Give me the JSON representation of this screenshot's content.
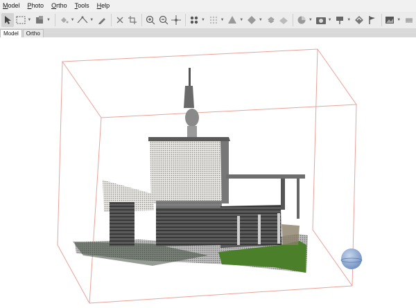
{
  "menu": [
    {
      "label": "Model",
      "underline": "M",
      "rest": "odel"
    },
    {
      "label": "Photo",
      "underline": "P",
      "rest": "hoto"
    },
    {
      "label": "Ortho",
      "underline": "O",
      "rest": "rtho"
    },
    {
      "label": "Tools",
      "underline": "T",
      "rest": "ools"
    },
    {
      "label": "Help",
      "underline": "H",
      "rest": "elp"
    }
  ],
  "tabs": [
    {
      "label": "Model",
      "active": true
    },
    {
      "label": "Ortho",
      "active": false
    }
  ],
  "toolbar_icons": [
    "navigation-icon",
    "rectangle-selection-icon",
    "brush-selection-icon",
    "paint-bucket-icon",
    "ruler-icon",
    "pencil-icon",
    "delete-icon",
    "crop-icon",
    "zoom-in-icon",
    "zoom-out-icon",
    "move-icon",
    "show-points-icon",
    "show-dense-cloud-icon",
    "show-mesh-icon",
    "show-texture-icon",
    "show-tiled-model-icon",
    "show-dem-icon",
    "camera-icon",
    "show-markers-icon",
    "show-shapes-icon",
    "show-images-icon",
    "region-icon"
  ],
  "colors": {
    "bounding_box": "#e8a39a",
    "navigation_sphere": "#7b9ac6",
    "grass": "#4c7f2a"
  }
}
